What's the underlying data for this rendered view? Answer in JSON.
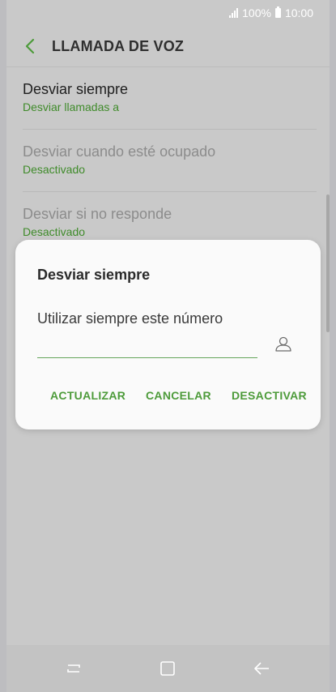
{
  "status_bar": {
    "battery_text": "100%",
    "time": "10:00"
  },
  "app_bar": {
    "title": "LLAMADA DE VOZ"
  },
  "settings": [
    {
      "title": "Desviar siempre",
      "subtitle": "Desviar llamadas a",
      "enabled": true
    },
    {
      "title": "Desviar cuando esté ocupado",
      "subtitle": "Desactivado",
      "enabled": false
    },
    {
      "title": "Desviar si no responde",
      "subtitle": "Desactivado",
      "enabled": false
    }
  ],
  "dialog": {
    "title": "Desviar siempre",
    "label": "Utilizar siempre este número",
    "input_value": "",
    "actions": {
      "update": "ACTUALIZAR",
      "cancel": "CANCELAR",
      "deactivate": "DESACTIVAR"
    }
  },
  "colors": {
    "accent_green": "#4d9b3a",
    "subtitle_green": "#3f8b2a",
    "input_underline": "#64a55a",
    "dim_background": "#c9c9c9"
  }
}
